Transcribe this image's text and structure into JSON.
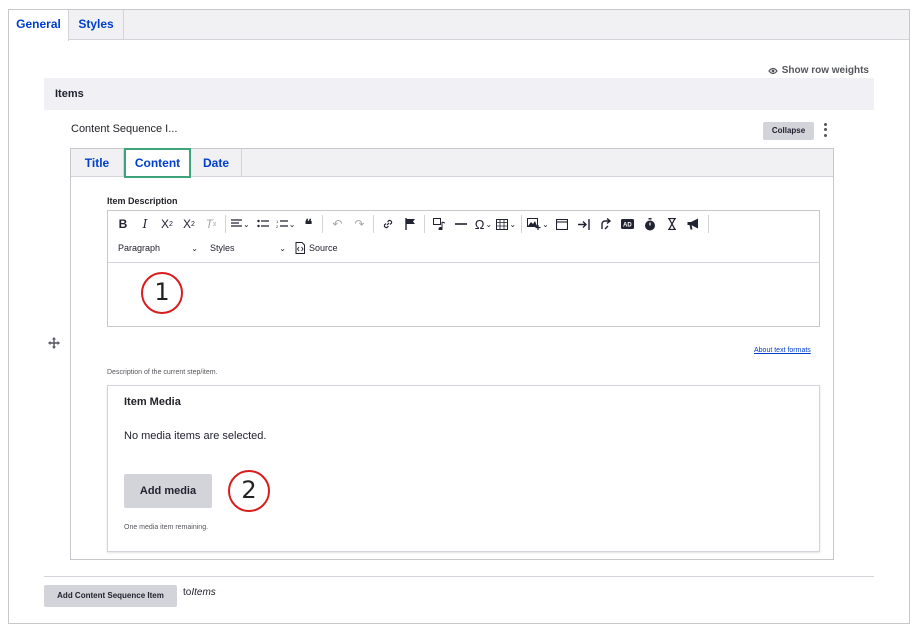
{
  "top_tabs": [
    {
      "label": "General",
      "active": true
    },
    {
      "label": "Styles",
      "active": false
    }
  ],
  "show_row_weights": "Show row weights",
  "items_header": "Items",
  "row": {
    "label": "Content Sequence I...",
    "collapse_label": "Collapse"
  },
  "inner_tabs": [
    {
      "label": "Title",
      "active": false
    },
    {
      "label": "Content",
      "active": true
    },
    {
      "label": "Date",
      "active": false
    }
  ],
  "item_description": {
    "label": "Item Description",
    "toolbar": {
      "row1": [
        "bold-icon",
        "italic-icon",
        "superscript-icon",
        "subscript-icon",
        "remove-format-icon",
        "align-icon",
        "bulleted-list-icon",
        "numbered-list-icon",
        "blockquote-icon",
        "undo-icon",
        "redo-icon",
        "link-icon",
        "anchor-flag-icon",
        "media-embed-icon",
        "horizontal-line-icon",
        "special-characters-icon",
        "table-icon",
        "insert-image-icon",
        "container-icon",
        "go-to-icon",
        "redirect-icon",
        "ad-icon",
        "timer-icon",
        "hourglass-icon",
        "announcement-icon"
      ],
      "paragraph_label": "Paragraph",
      "styles_label": "Styles",
      "source_label": "Source"
    },
    "about_formats": "About text formats",
    "description": "Description of the current step/item."
  },
  "item_media": {
    "title": "Item Media",
    "empty_text": "No media items are selected.",
    "add_label": "Add media",
    "remaining": "One media item remaining."
  },
  "markers": [
    "1",
    "2"
  ],
  "bottom": {
    "add_button": "Add Content Sequence Item",
    "to_prefix": "to",
    "to_target": "Items"
  },
  "colors": {
    "link": "#003ecc",
    "active_tab_border": "#3fa37b",
    "marker": "#d81d1d",
    "button_bg": "#d3d4d9"
  }
}
